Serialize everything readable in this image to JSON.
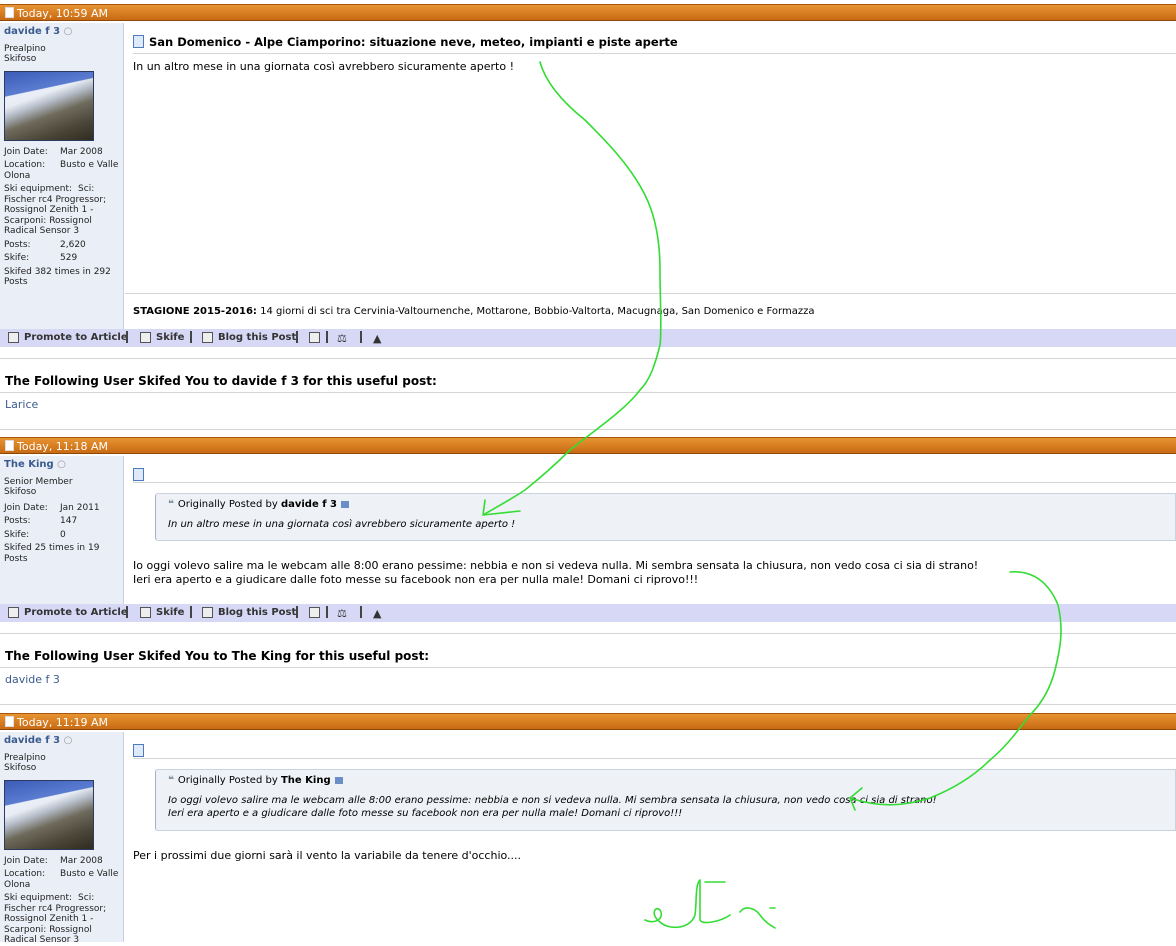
{
  "posts": [
    {
      "timestamp": "Today, 10:59 AM",
      "user": {
        "name": "davide f 3",
        "title1": "Prealpino",
        "title2": "Skifoso",
        "join_label": "Join Date:",
        "join_value": "Mar 2008",
        "location_label": "Location:",
        "location_value": "Busto e Valle Olona",
        "equipment_label": "Ski equipment:",
        "equipment_value": "Sci: Fischer rc4 Progressor; Rossignol Zenith 1 - Scarponi: Rossignol Radical Sensor 3",
        "posts_label": "Posts:",
        "posts_value": "2,620",
        "skife_label": "Skife:",
        "skife_value": "529",
        "skifed_text": "Skifed 382 times in 292 Posts"
      },
      "title": "San Domenico - Alpe Ciamporino: situazione neve, meteo, impianti e piste aperte",
      "body": "In un altro mese in una giornata così avrebbero sicuramente aperto !",
      "signature_label": "STAGIONE 2015-2016:",
      "signature_text": " 14 giorni di sci tra Cervinia-Valtournenche, Mottarone, Bobbio-Valtorta, Macugnaga, San Domenico e Formazza",
      "skifed_heading": "The Following User Skifed You to davide f 3 for this useful post:",
      "skifed_users": "Larice"
    },
    {
      "timestamp": "Today, 11:18 AM",
      "user": {
        "name": "The King",
        "title1": "Senior Member",
        "title2": "Skifoso",
        "join_label": "Join Date:",
        "join_value": "Jan 2011",
        "posts_label": "Posts:",
        "posts_value": "147",
        "skife_label": "Skife:",
        "skife_value": "0",
        "skifed_text": "Skifed 25 times in 19 Posts"
      },
      "quote_prefix": "Originally Posted by",
      "quote_author": "davide f 3",
      "quote_text": "In un altro mese in una giornata così avrebbero sicuramente aperto !",
      "body_line1": "Io oggi volevo salire ma le webcam alle 8:00 erano pessime: nebbia e non si vedeva nulla. Mi sembra sensata la chiusura, non vedo cosa ci sia di strano!",
      "body_line2": "Ieri era aperto e a giudicare dalle foto messe su facebook non era per nulla male! Domani ci riprovo!!!",
      "skifed_heading": "The Following User Skifed You to The King for this useful post:",
      "skifed_users": "davide f 3"
    },
    {
      "timestamp": "Today, 11:19 AM",
      "user": {
        "name": "davide f 3",
        "title1": "Prealpino",
        "title2": "Skifoso",
        "join_label": "Join Date:",
        "join_value": "Mar 2008",
        "location_label": "Location:",
        "location_value": "Busto e Valle Olona",
        "equipment_label": "Ski equipment:",
        "equipment_value": "Sci: Fischer rc4 Progressor; Rossignol Zenith 1 - Scarponi: Rossignol Radical Sensor 3"
      },
      "quote_prefix": "Originally Posted by",
      "quote_author": "The King",
      "quote_line1": "Io oggi volevo salire ma le webcam alle 8:00 erano pessime: nebbia e non si vedeva nulla. Mi sembra sensata la chiusura, non vedo cosa ci sia di strano!",
      "quote_line2": "Ieri era aperto e a giudicare dalle foto messe su facebook non era per nulla male! Domani ci riprovo!!!",
      "body": "Per i prossimi due giorni sarà il vento la variabile da tenere d'occhio...."
    }
  ],
  "toolbar": {
    "promote": "Promote to Article",
    "skife": "Skife",
    "blog": "Blog this Post"
  },
  "colors": {
    "header_bar": "#c86a13",
    "toolbar_bg": "#d6d8f5",
    "annotation": "#33dd33",
    "user_col_bg": "#eaeef7"
  }
}
